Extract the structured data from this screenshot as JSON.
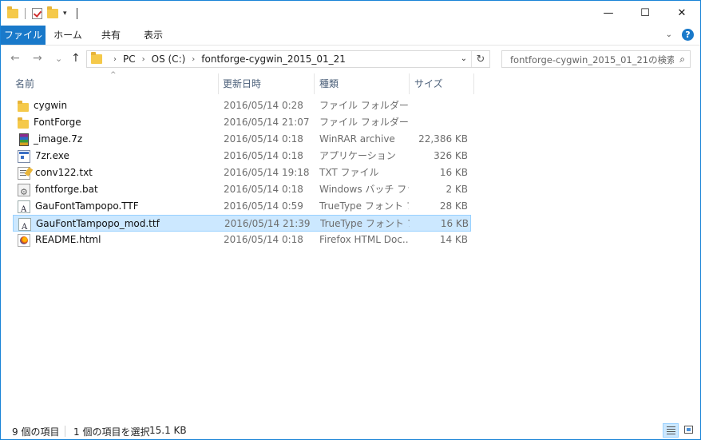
{
  "titlebar": {
    "minimize_glyph": "—",
    "maximize_glyph": "☐",
    "close_glyph": "✕",
    "qat_dropdown_glyph": "▾"
  },
  "ribbon": {
    "tabs": [
      {
        "label": "ファイル",
        "active": true
      },
      {
        "label": "ホーム"
      },
      {
        "label": "共有"
      },
      {
        "label": "表示"
      }
    ],
    "expand_glyph": "⌄",
    "help_glyph": "?"
  },
  "nav": {
    "back_glyph": "←",
    "forward_glyph": "→",
    "recent_glyph": "⌄",
    "up_glyph": "↑",
    "breadcrumb": [
      "PC",
      "OS (C:)",
      "fontforge-cygwin_2015_01_21"
    ],
    "dropdown_glyph": "⌄",
    "refresh_glyph": "↻",
    "search_placeholder": "fontforge-cygwin_2015_01_21の検索",
    "search_glyph": "⌕"
  },
  "columns": {
    "name": "名前",
    "date": "更新日時",
    "type": "種類",
    "size": "サイズ",
    "sort_glyph": "^"
  },
  "files": [
    {
      "name": "cygwin",
      "date": "2016/05/14 0:28",
      "type": "ファイル フォルダー",
      "size": "",
      "icon": "folder-icon"
    },
    {
      "name": "FontForge",
      "date": "2016/05/14 21:07",
      "type": "ファイル フォルダー",
      "size": "",
      "icon": "folder-icon"
    },
    {
      "name": "_image.7z",
      "date": "2016/05/14 0:18",
      "type": "WinRAR archive",
      "size": "22,386 KB",
      "icon": "winrar-archive-icon"
    },
    {
      "name": "7zr.exe",
      "date": "2016/05/14 0:18",
      "type": "アプリケーション",
      "size": "326 KB",
      "icon": "application-icon"
    },
    {
      "name": "conv122.txt",
      "date": "2016/05/14 19:18",
      "type": "TXT ファイル",
      "size": "16 KB",
      "icon": "text-file-icon"
    },
    {
      "name": "fontforge.bat",
      "date": "2016/05/14 0:18",
      "type": "Windows バッチ ファ...",
      "size": "2 KB",
      "icon": "batch-file-icon"
    },
    {
      "name": "GauFontTampopo.TTF",
      "date": "2016/05/14 0:59",
      "type": "TrueType フォント フ...",
      "size": "28 KB",
      "icon": "font-file-icon"
    },
    {
      "name": "GauFontTampopo_mod.ttf",
      "date": "2016/05/14 21:39",
      "type": "TrueType フォント フ...",
      "size": "16 KB",
      "icon": "font-file-icon",
      "selected": true
    },
    {
      "name": "README.html",
      "date": "2016/05/14 0:18",
      "type": "Firefox HTML Doc...",
      "size": "14 KB",
      "icon": "html-file-icon"
    }
  ],
  "status": {
    "item_count": "9 個の項目",
    "selection": "1 個の項目を選択",
    "selection_size": "15.1 KB"
  },
  "colors": {
    "accent": "#1979ca",
    "selection_bg": "#cce8ff",
    "selection_border": "#99d1ff"
  }
}
